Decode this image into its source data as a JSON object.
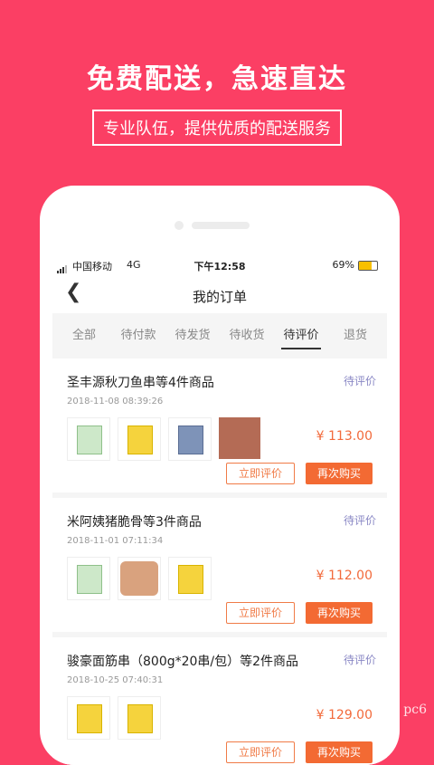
{
  "banner": {
    "headline": "免费配送，急速直达",
    "subline": "专业队伍，提供优质的配送服务"
  },
  "status_bar": {
    "carrier": "中国移动",
    "network": "4G",
    "time": "下午12:58",
    "battery": "69%",
    "battery_level": 0.69
  },
  "nav": {
    "back_icon": "chevron-left-icon",
    "title": "我的订单"
  },
  "tabs": [
    "全部",
    "待付款",
    "待发货",
    "待收货",
    "待评价",
    "退货"
  ],
  "active_tab": "待评价",
  "orders": [
    {
      "title": "圣丰源秋刀鱼串等4件商品",
      "status": "待评价",
      "date": "2018-11-08 08:39:26",
      "price": "¥ 113.00",
      "review_label": "立即评价",
      "rebuy_label": "再次购买"
    },
    {
      "title": "米阿姨猪脆骨等3件商品",
      "status": "待评价",
      "date": "2018-11-01 07:11:34",
      "price": "¥ 112.00",
      "review_label": "立即评价",
      "rebuy_label": "再次购买"
    },
    {
      "title": "骏豪面筋串（800g*20串/包）等2件商品",
      "status": "待评价",
      "date": "2018-10-25 07:40:31",
      "price": "¥ 129.00",
      "review_label": "立即评价",
      "rebuy_label": "再次购买"
    }
  ],
  "watermark": "pc6"
}
